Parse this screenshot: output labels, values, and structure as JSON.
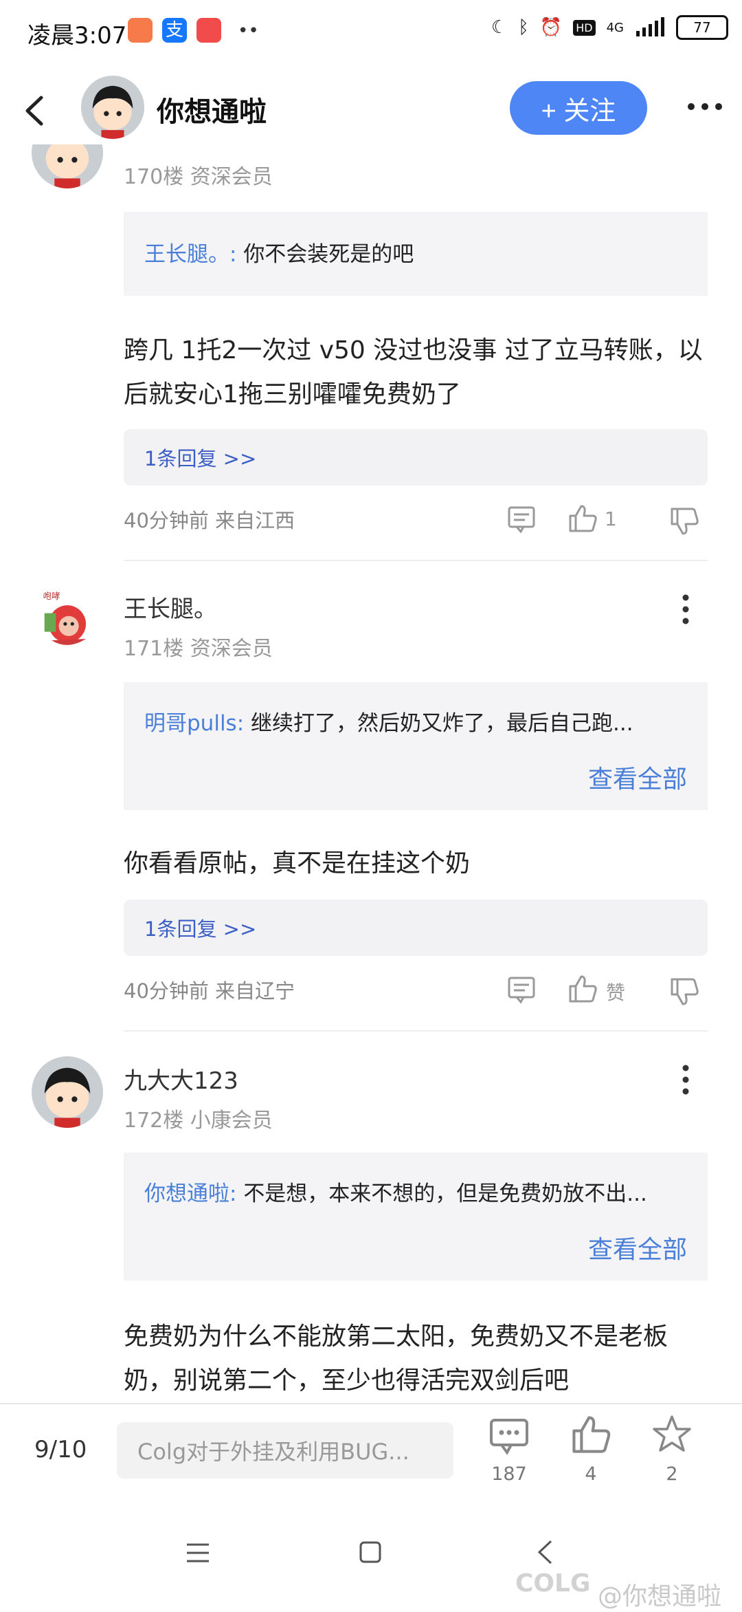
{
  "status_bar": {
    "time": "凌晨3:07",
    "network": "4G",
    "battery": "77",
    "hd": "HD"
  },
  "header": {
    "back": "back",
    "title": "你想通啦",
    "follow_label": "+ 关注"
  },
  "comments": [
    {
      "floor": "170楼 资深会员",
      "quote_name": "王长腿。:",
      "quote_text": "你不会装死是的吧",
      "content": "跨几  1托2一次过  v50  没过也没事 过了立马转账，以后就安心1拖三别嚯嚯免费奶了",
      "reply_label": "1条回复 >>",
      "time_loc": "40分钟前 来自江西",
      "likes": "1"
    },
    {
      "username": "王长腿。",
      "floor": "171楼 资深会员",
      "quote_name": "明哥pulls:",
      "quote_text": "继续打了，然后奶又炸了，最后自己跑...",
      "view_all": "查看全部",
      "content": "你看看原帖，真不是在挂这个奶",
      "reply_label": "1条回复 >>",
      "time_loc": "40分钟前 来自辽宁",
      "likes": "赞"
    },
    {
      "username": "九大大123",
      "floor": "172楼 小康会员",
      "quote_name": "你想通啦:",
      "quote_text": "不是想，本来不想的，但是免费奶放不出...",
      "view_all": "查看全部",
      "content": "免费奶为什么不能放第二太阳，免费奶又不是老板奶，别说第二个，至少也得活完双剑后吧"
    }
  ],
  "bottom_bar": {
    "page": "9/10",
    "input_placeholder": "Colg对于外挂及利用BUG...",
    "comment_count": "187",
    "like_count": "4",
    "star_count": "2"
  },
  "watermark": "@你想通啦",
  "watermark_logo": "COLG",
  "colors": {
    "accent": "#4e86f6",
    "link": "#4a7fd8"
  }
}
